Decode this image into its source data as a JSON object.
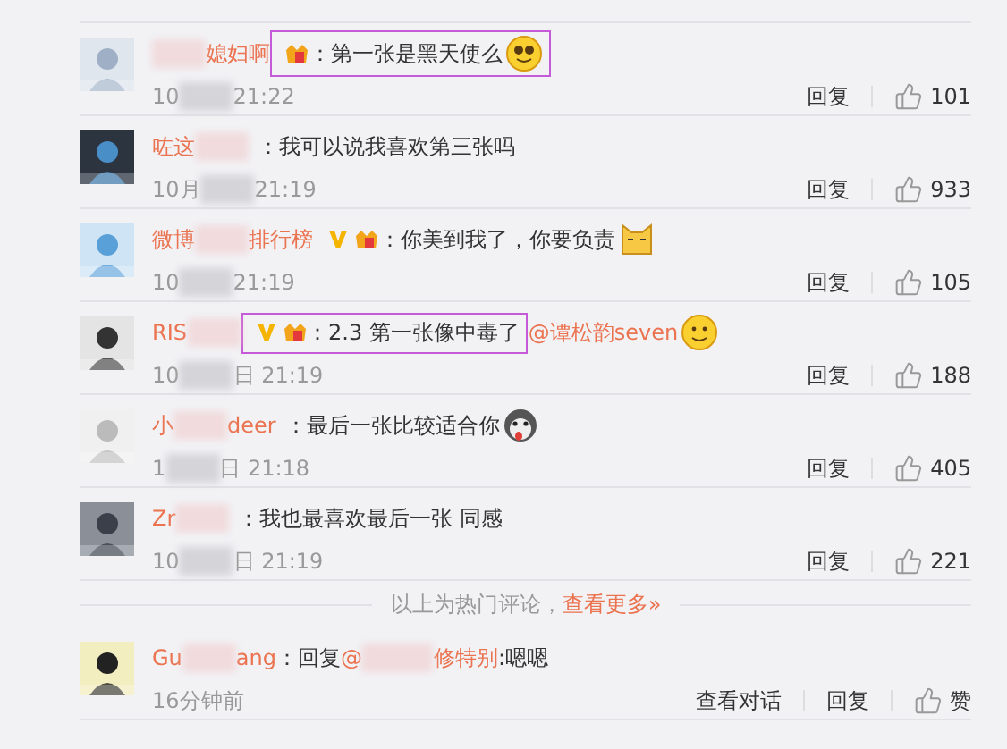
{
  "comments": [
    {
      "name_end": "媳妇啊",
      "badges": [
        {
          "kind": "fan"
        }
      ],
      "text": "：第一张是黑天使么",
      "emoji": {
        "kind": "pleading"
      },
      "highlighted": true,
      "time_start": "10",
      "time_end": "21:22",
      "actions": [
        "回复"
      ],
      "likes": "101"
    },
    {
      "name_start": "咗这",
      "text": "：我可以说我喜欢第三张吗",
      "highlighted": false,
      "time_start": "10月",
      "time_end": "21:19",
      "actions": [
        "回复"
      ],
      "likes": "933"
    },
    {
      "name_start": "微博",
      "name_end": "排行榜",
      "badges": [
        {
          "kind": "verified"
        },
        {
          "kind": "fan"
        }
      ],
      "text": "：你美到我了，你要负责",
      "emoji": {
        "kind": "cat"
      },
      "highlighted": false,
      "time_start": "10",
      "time_end": "21:19",
      "actions": [
        "回复"
      ],
      "likes": "105"
    },
    {
      "name_start": "RIS",
      "badges": [
        {
          "kind": "verified"
        },
        {
          "kind": "fan"
        }
      ],
      "text": "：2.3 第一张像中毒了",
      "mention": "@谭松韵seven",
      "emoji": {
        "kind": "smile"
      },
      "highlighted": true,
      "time_start": "10",
      "time_end": "日 21:19",
      "actions": [
        "回复"
      ],
      "likes": "188"
    },
    {
      "name_start": "小",
      "name_end": "deer",
      "text": "：最后一张比较适合你",
      "emoji": {
        "kind": "husky"
      },
      "highlighted": false,
      "time_start": "1",
      "time_end": "日 21:18",
      "actions": [
        "回复"
      ],
      "likes": "405"
    },
    {
      "name_start": "Zr",
      "text": "：我也最喜欢最后一张 同感",
      "highlighted": false,
      "time_start": "10",
      "time_end": "日 21:19",
      "actions": [
        "回复"
      ],
      "likes": "221"
    }
  ],
  "hot_divider": {
    "text": "以上为热门评论，",
    "link": "查看更多»"
  },
  "reply": {
    "name_start": "Gu",
    "name_end": "ang",
    "prefix": "：回复",
    "mention_start": "@",
    "mention_end": "修特别",
    "suffix": ":嗯嗯",
    "time": "16分钟前",
    "actions": [
      "查看对话",
      "回复"
    ],
    "likes": "赞"
  }
}
